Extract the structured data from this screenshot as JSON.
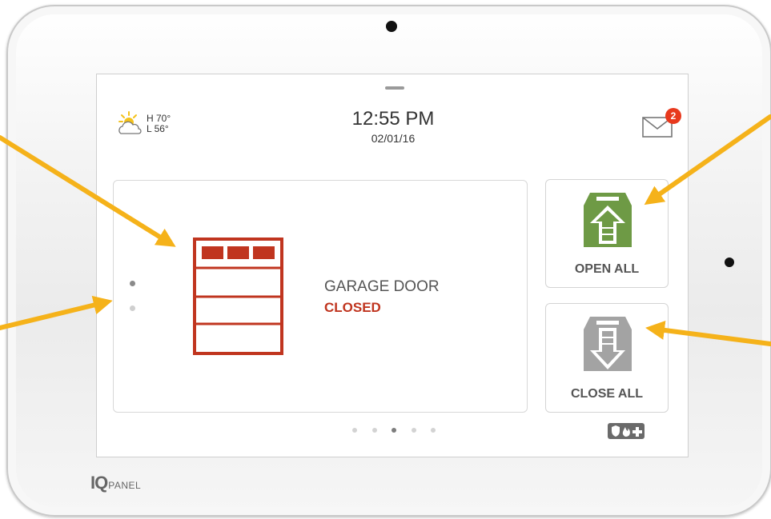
{
  "header": {
    "weather": {
      "icon": "partly-sunny-icon",
      "high": "H 70°",
      "low": "L 56°"
    },
    "time": "12:55 PM",
    "date": "02/01/16",
    "messages": {
      "icon": "envelope-icon",
      "badge": "2"
    }
  },
  "main_card": {
    "device_icon": "garage-door-icon",
    "device_name": "GARAGE DOOR",
    "status": "CLOSED",
    "status_color": "#c0351f"
  },
  "actions": {
    "open_all": {
      "label": "OPEN ALL",
      "icon": "garage-open-icon",
      "color": "#6e9a45"
    },
    "close_all": {
      "label": "CLOSE ALL",
      "icon": "garage-close-icon",
      "color": "#a3a3a3"
    }
  },
  "pager": {
    "pages": 5,
    "active": 3
  },
  "emergency_icons": [
    "shield-icon",
    "fire-icon",
    "plus-icon"
  ],
  "brand": {
    "logo": "IQ",
    "suffix": "PANEL"
  },
  "annotation_color": "#f5b21a"
}
